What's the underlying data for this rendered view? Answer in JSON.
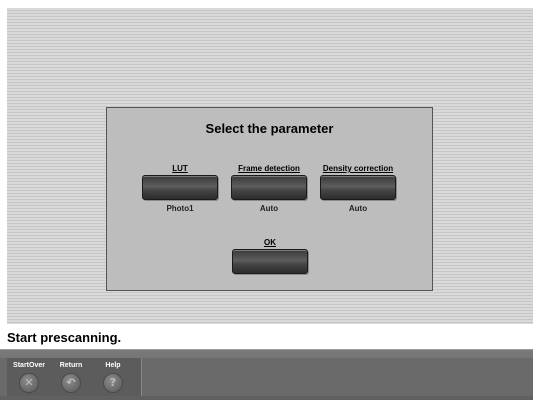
{
  "dialog": {
    "title": "Select the parameter",
    "params": [
      {
        "label": "LUT",
        "value": "Photo1"
      },
      {
        "label": "Frame detection",
        "value": "Auto"
      },
      {
        "label": "Density correction",
        "value": "Auto"
      }
    ],
    "ok_label": "OK"
  },
  "status": {
    "message": "Start prescanning."
  },
  "toolbar": {
    "startover_label": "StartOver",
    "return_label": "Return",
    "help_label": "Help",
    "startover_icon": "x-icon",
    "return_icon": "return-arrow-icon",
    "help_icon": "question-icon"
  }
}
